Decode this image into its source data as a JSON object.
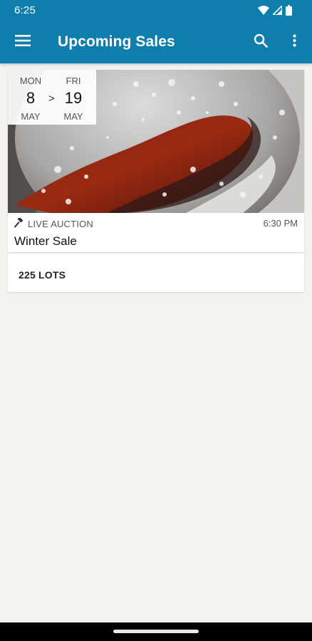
{
  "status_bar": {
    "time": "6:25",
    "icons": [
      "wifi-icon",
      "cell-signal-icon",
      "battery-icon"
    ]
  },
  "app_bar": {
    "title": "Upcoming Sales",
    "icons": [
      "menu-icon",
      "search-icon",
      "more-vert-icon"
    ],
    "color": "#0e7fad"
  },
  "sales": [
    {
      "start": {
        "dow": "MON",
        "day": "8",
        "month": "MAY"
      },
      "separator": ">",
      "end": {
        "dow": "FRI",
        "day": "19",
        "month": "MAY"
      },
      "auction_type": "LIVE AUCTION",
      "auction_icon": "gavel-icon",
      "time": "6:30 PM",
      "title": "Winter Sale",
      "lots": "225 LOTS"
    }
  ],
  "colors": {
    "background": "#f3f2ef",
    "card": "#ffffff"
  }
}
